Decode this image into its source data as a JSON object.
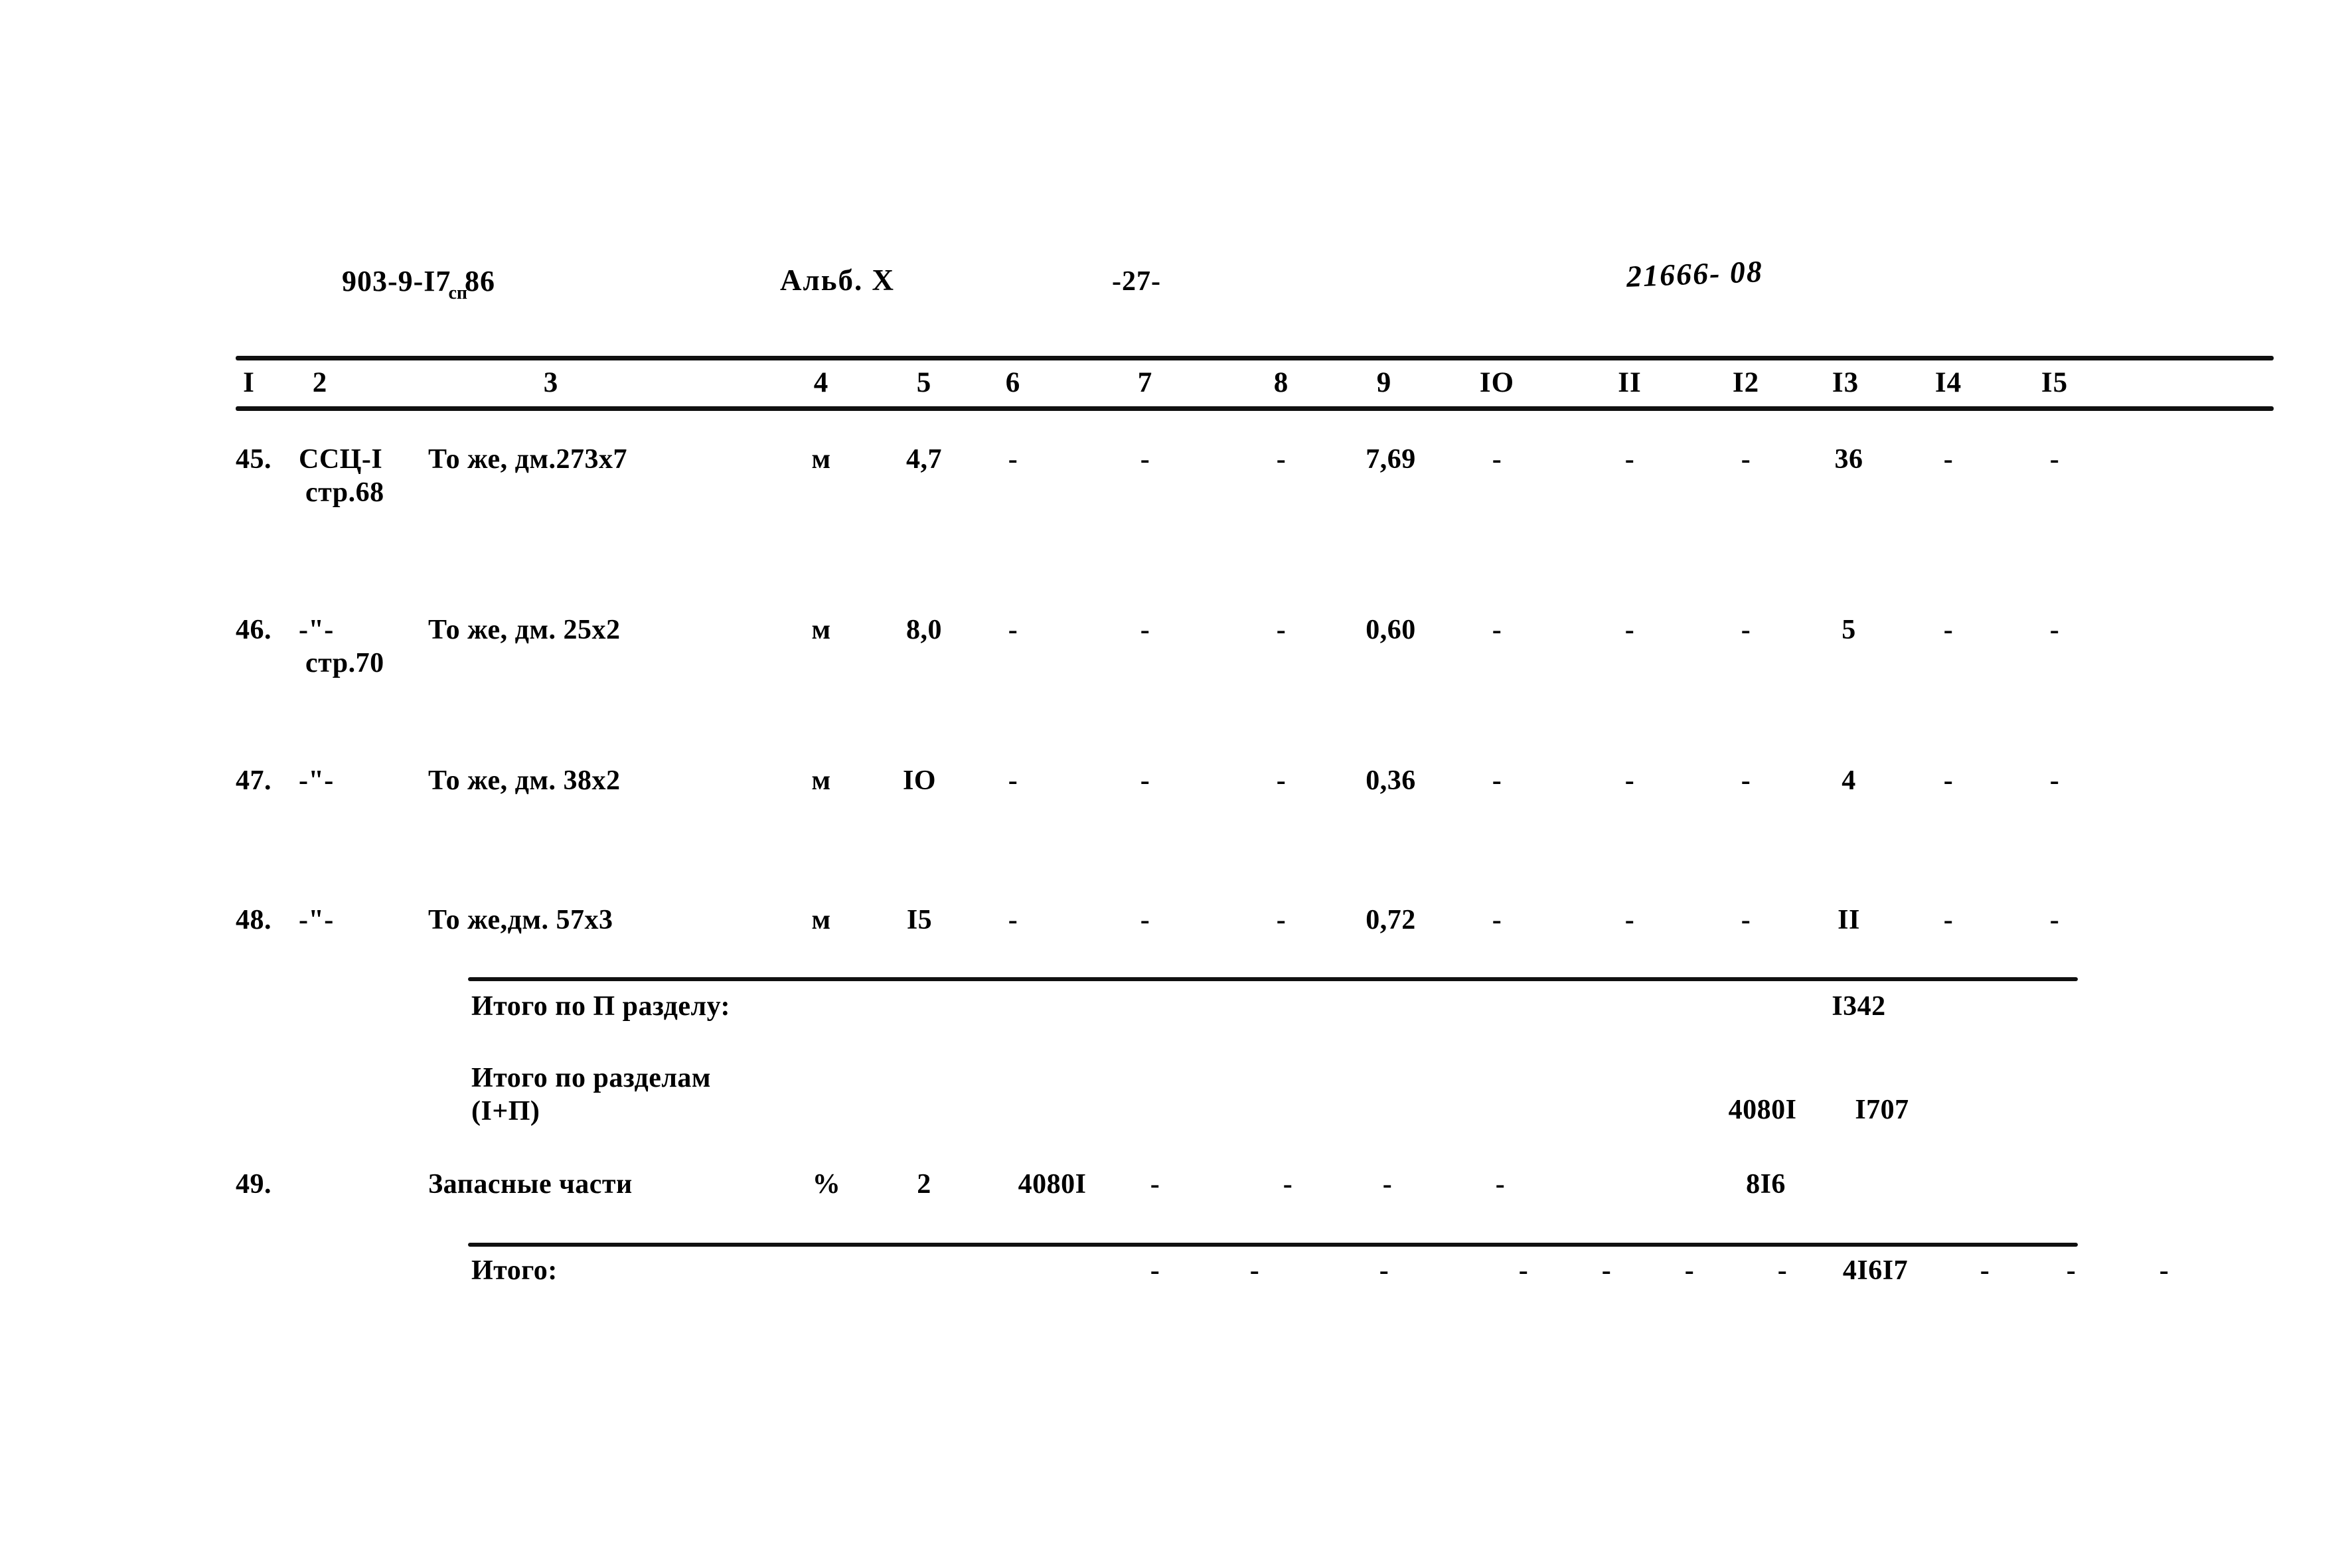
{
  "page": {
    "doc_code_main": "903-9-I7",
    "doc_code_sub": "сп",
    "doc_code_tail": "86",
    "album": "Альб. X",
    "page_number": "-27-",
    "hand_reference": "21666- 08"
  },
  "table": {
    "column_numbers": [
      "I",
      "2",
      "3",
      "4",
      "5",
      "6",
      "7",
      "8",
      "9",
      "IO",
      "II",
      "I2",
      "I3",
      "I4",
      "I5"
    ],
    "rows": [
      {
        "num": "45.",
        "ref": "ССЦ-I",
        "ref2": "стр.68",
        "name": "То же, дм.273х7",
        "unit": "м",
        "c5": "4,7",
        "c6": "-",
        "c7": "-",
        "c8": "-",
        "c9": "7,69",
        "c10": "-",
        "c11": "-",
        "c12": "-",
        "c13": "36",
        "c14": "-",
        "c15": "-"
      },
      {
        "num": "46.",
        "ref": "-\"-",
        "ref2": "стр.70",
        "name": "То же, дм. 25х2",
        "unit": "м",
        "c5": "8,0",
        "c6": "-",
        "c7": "-",
        "c8": "-",
        "c9": "0,60",
        "c10": "-",
        "c11": "-",
        "c12": "-",
        "c13": "5",
        "c14": "-",
        "c15": "-"
      },
      {
        "num": "47.",
        "ref": "-\"-",
        "ref2": "",
        "name": "То же, дм. 38х2",
        "unit": "м",
        "c5": "IO",
        "c6": "-",
        "c7": "-",
        "c8": "-",
        "c9": "0,36",
        "c10": "-",
        "c11": "-",
        "c12": "-",
        "c13": "4",
        "c14": "-",
        "c15": "-"
      },
      {
        "num": "48.",
        "ref": "-\"-",
        "ref2": "",
        "name": "То же,дм. 57х3",
        "unit": "м",
        "c5": "I5",
        "c6": "-",
        "c7": "-",
        "c8": "-",
        "c9": "0,72",
        "c10": "-",
        "c11": "-",
        "c12": "-",
        "c13": "II",
        "c14": "-",
        "c15": "-"
      }
    ],
    "subtotal_section": {
      "label": "Итого по П разделу:",
      "c13": "I342"
    },
    "subtotal_sections": {
      "label_line1": "Итого по разделам",
      "label_line2": "(I+П)",
      "c12": "4080I",
      "c13": "I707"
    },
    "spare_parts_row": {
      "num": "49.",
      "name": "Запасные части",
      "unit": "%",
      "c5": "2",
      "c6": "4080I",
      "c7": "-",
      "c8": "-",
      "c9": "-",
      "c10": "-",
      "c12": "8I6"
    },
    "grand_total": {
      "label": "Итого:",
      "c5": "-",
      "c6": "-",
      "c7": "-",
      "c8": "-",
      "c9": "-",
      "c10": "-",
      "c11": "-",
      "c12": "4I6I7",
      "c13": "-",
      "c14": "-",
      "c15": "-"
    }
  }
}
